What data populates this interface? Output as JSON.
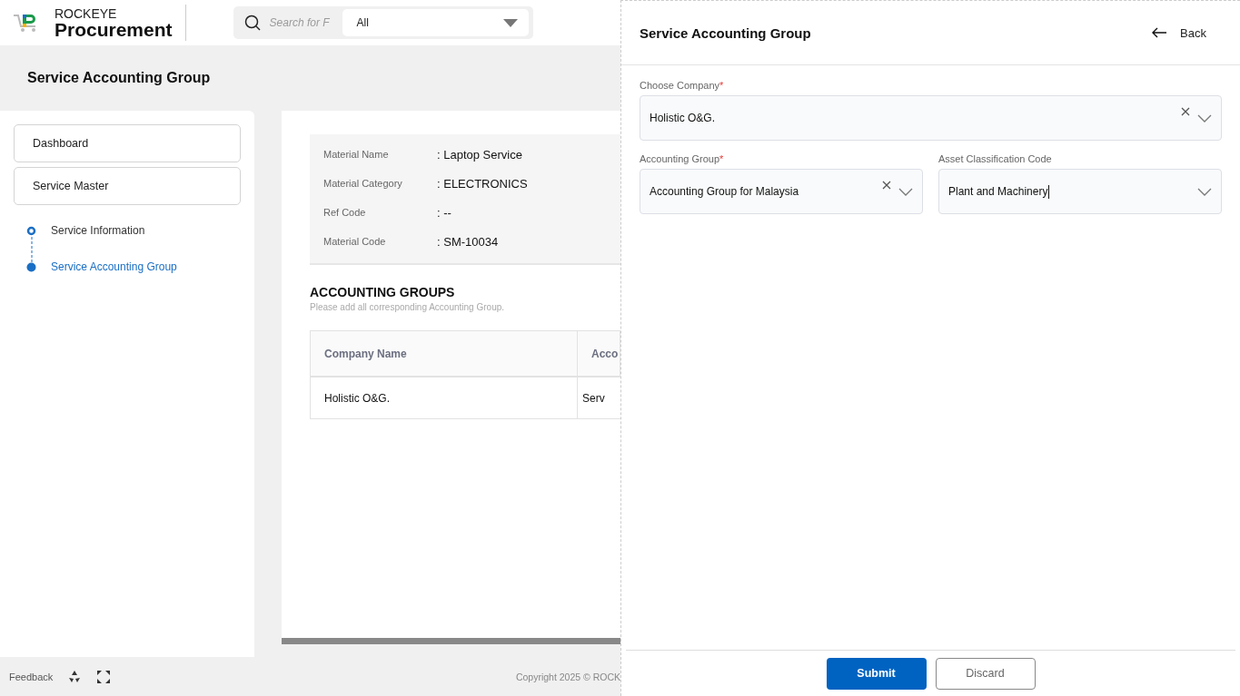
{
  "header": {
    "brand_top": "ROCKEYE",
    "brand_name": "Procurement",
    "search": {
      "placeholder": "Search for F"
    },
    "filter": {
      "value": "All"
    }
  },
  "page_title": "Service Accounting Group",
  "sidebar": {
    "items": [
      {
        "label": "Dashboard"
      },
      {
        "label": "Service Master"
      }
    ],
    "steps": [
      {
        "label": "Service Information",
        "selected": false
      },
      {
        "label": "Service Accounting Group",
        "selected": true
      }
    ]
  },
  "details": [
    {
      "label": "Material Name",
      "value": ": Laptop Service"
    },
    {
      "label": "Material Category",
      "value": ": ELECTRONICS"
    },
    {
      "label": "Ref Code",
      "value": ": --"
    },
    {
      "label": "Material Code",
      "value": ": SM-10034"
    }
  ],
  "accounting_groups": {
    "title": "ACCOUNTING GROUPS",
    "subtitle": "Please add all corresponding Accounting Group.",
    "table": {
      "columns": [
        "Company Name",
        "Acco"
      ],
      "rows": [
        [
          "Holistic O&G.",
          "Serv"
        ]
      ]
    }
  },
  "footer": {
    "feedback": "Feedback",
    "copyright": "Copyright 2025 © ROCK"
  },
  "drawer": {
    "title": "Service Accounting Group",
    "back": "Back",
    "required_mark": "*",
    "fields": [
      {
        "label": "Choose Company",
        "required": true,
        "value": "Holistic O&G.",
        "clearable": true,
        "focused": false
      },
      {
        "label": "Accounting Group",
        "required": true,
        "value": "Accounting Group for Malaysia",
        "clearable": true,
        "focused": false
      },
      {
        "label": "Asset Classification Code",
        "required": false,
        "value": "Plant and Machinery",
        "clearable": false,
        "focused": true
      }
    ],
    "buttons": [
      {
        "label": "Submit",
        "kind": "primary"
      },
      {
        "label": "Discard",
        "kind": "secondary"
      }
    ]
  }
}
